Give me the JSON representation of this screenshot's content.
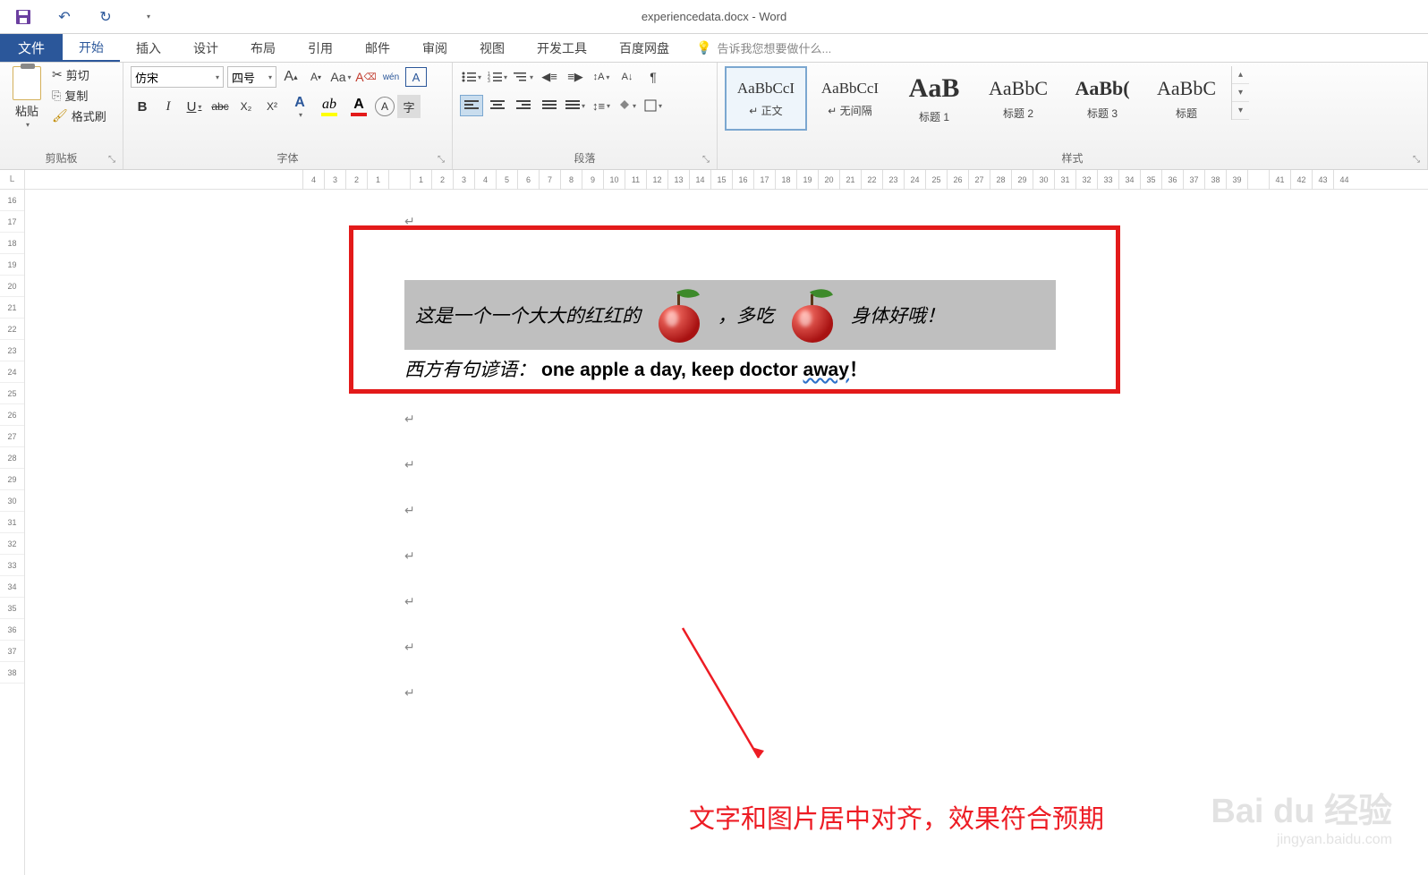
{
  "title": "experiencedata.docx - Word",
  "qat": {
    "save": "save-icon",
    "undo": "↶",
    "redo": "↻"
  },
  "tabs": {
    "file": "文件",
    "home": "开始",
    "insert": "插入",
    "design": "设计",
    "layout": "布局",
    "references": "引用",
    "mailings": "邮件",
    "review": "审阅",
    "view": "视图",
    "developer": "开发工具",
    "baidu": "百度网盘"
  },
  "tellme": "告诉我您想要做什么...",
  "clipboard": {
    "paste": "粘贴",
    "cut": "剪切",
    "copy": "复制",
    "format_painter": "格式刷",
    "group": "剪贴板"
  },
  "font": {
    "name": "仿宋",
    "size": "四号",
    "group": "字体",
    "grow": "A",
    "shrink": "A",
    "case": "Aa",
    "clear": "A",
    "pinyin": "wén",
    "charborder": "A",
    "bold": "B",
    "italic": "I",
    "underline": "U",
    "strike": "abc",
    "sub": "X₂",
    "sup": "X²",
    "texteffect": "A",
    "highlight": "A",
    "fontcolor": "A",
    "circled": "A",
    "shading": "字"
  },
  "paragraph": {
    "group": "段落"
  },
  "styles": {
    "group": "样式",
    "items": [
      {
        "preview": "AaBbCcI",
        "name": "↵ 正文",
        "sel": true,
        "size": "17px",
        "weight": "normal"
      },
      {
        "preview": "AaBbCcI",
        "name": "↵ 无间隔",
        "size": "17px",
        "weight": "normal"
      },
      {
        "preview": "AaB",
        "name": "标题 1",
        "size": "30px",
        "weight": "bold"
      },
      {
        "preview": "AaBbC",
        "name": "标题 2",
        "size": "22px",
        "weight": "normal"
      },
      {
        "preview": "AaBb(",
        "name": "标题 3",
        "size": "22px",
        "weight": "bold"
      },
      {
        "preview": "AaBbC",
        "name": "标题",
        "size": "22px",
        "weight": "normal"
      }
    ]
  },
  "document": {
    "line1_a": "这是一个一个大大的红红的",
    "line1_b": "，多吃",
    "line1_c": "身体好哦！",
    "line2_cn": "西方有句谚语：",
    "line2_en": "one apple a day, keep doctor ",
    "line2_away": "away",
    "line2_bang": "！",
    "pmark": "↵"
  },
  "annotation": "文字和图片居中对齐，效果符合预期",
  "watermark": {
    "main": "Bai du 经验",
    "sub": "jingyan.baidu.com"
  },
  "hruler": [
    "4",
    "3",
    "2",
    "1",
    "",
    "1",
    "2",
    "3",
    "4",
    "5",
    "6",
    "7",
    "8",
    "9",
    "10",
    "11",
    "12",
    "13",
    "14",
    "15",
    "16",
    "17",
    "18",
    "19",
    "20",
    "21",
    "22",
    "23",
    "24",
    "25",
    "26",
    "27",
    "28",
    "29",
    "30",
    "31",
    "32",
    "33",
    "34",
    "35",
    "36",
    "37",
    "38",
    "39",
    "",
    "41",
    "42",
    "43",
    "44"
  ],
  "vruler": [
    "16",
    "17",
    "18",
    "19",
    "20",
    "21",
    "22",
    "23",
    "24",
    "25",
    "26",
    "27",
    "28",
    "29",
    "30",
    "31",
    "32",
    "33",
    "34",
    "35",
    "36",
    "37",
    "38"
  ]
}
